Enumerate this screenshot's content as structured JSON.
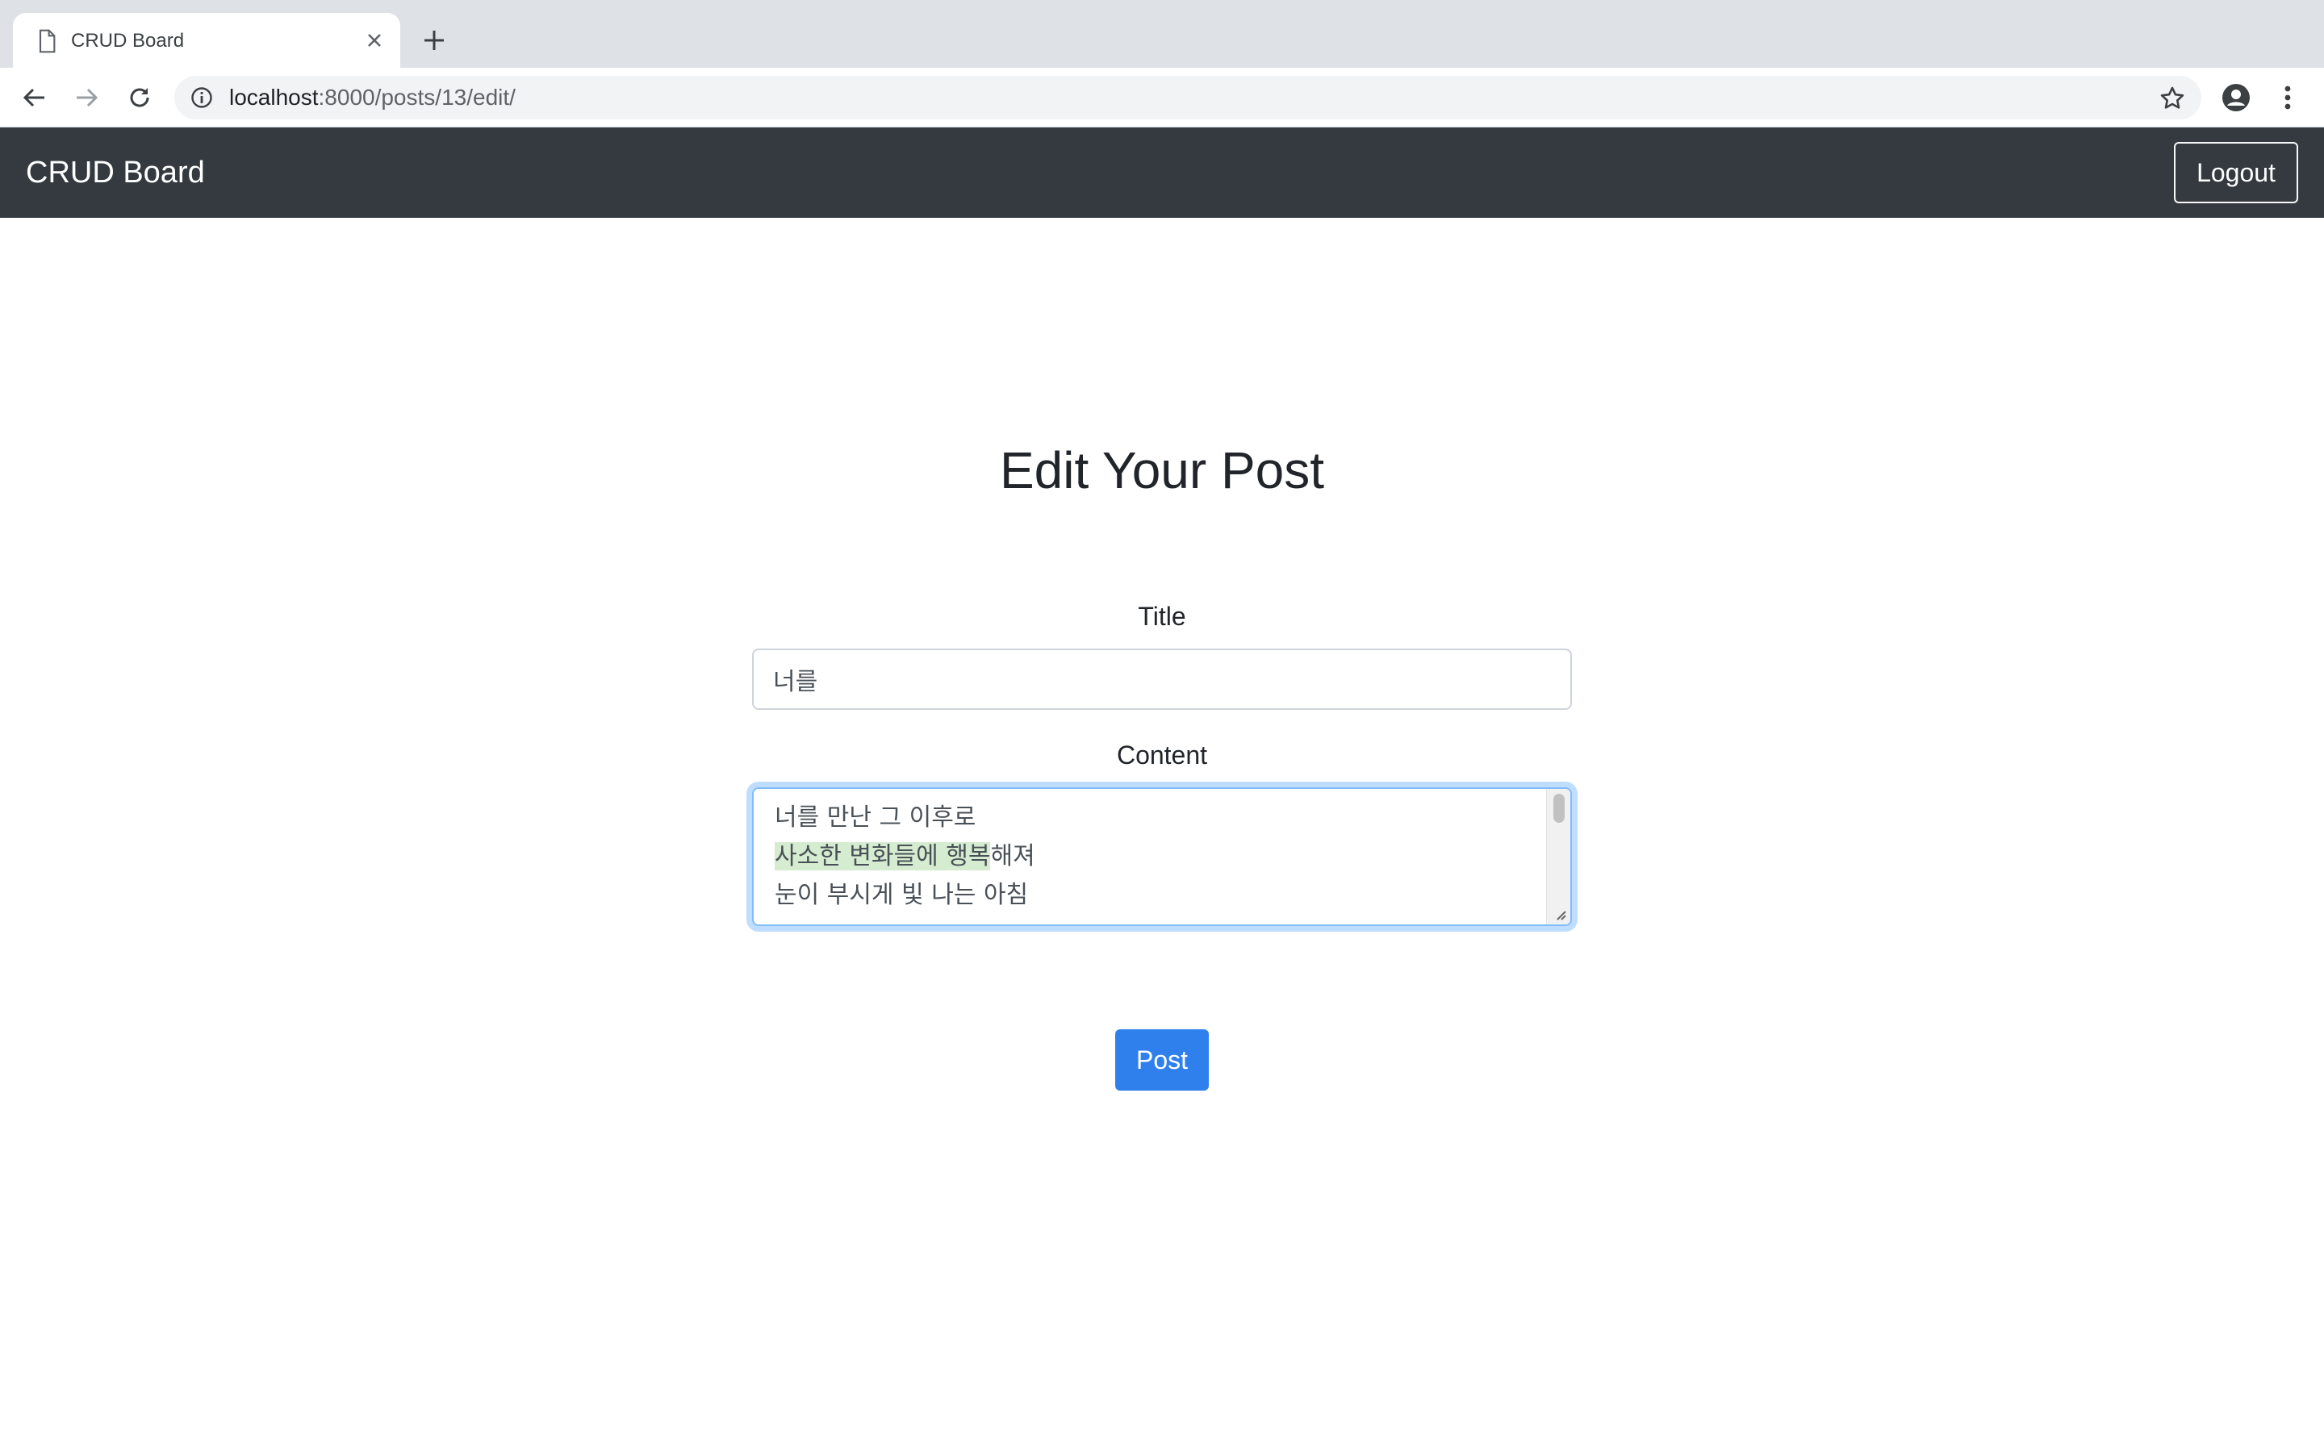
{
  "browser": {
    "tab_title": "CRUD Board",
    "url_host": "localhost",
    "url_path": ":8000/posts/13/edit/",
    "icons": [
      "page-icon",
      "close-icon",
      "plus-icon",
      "back-icon",
      "forward-icon",
      "reload-icon",
      "info-icon",
      "star-icon",
      "account-icon",
      "more-vert-icon"
    ]
  },
  "navbar": {
    "brand": "CRUD Board",
    "logout_label": "Logout",
    "background": "#343a40"
  },
  "form": {
    "heading": "Edit Your Post",
    "title_label": "Title",
    "title_value": "너를",
    "content_label": "Content",
    "content_lines": {
      "line1": "너를 만난 그 이후로",
      "line2_highlighted": "사소한 변화들에 행복",
      "line2_rest": "해져",
      "line3": "눈이 부시게 빛 나는 아침"
    },
    "submit_label": "Post",
    "accent": "#2f80ed"
  }
}
